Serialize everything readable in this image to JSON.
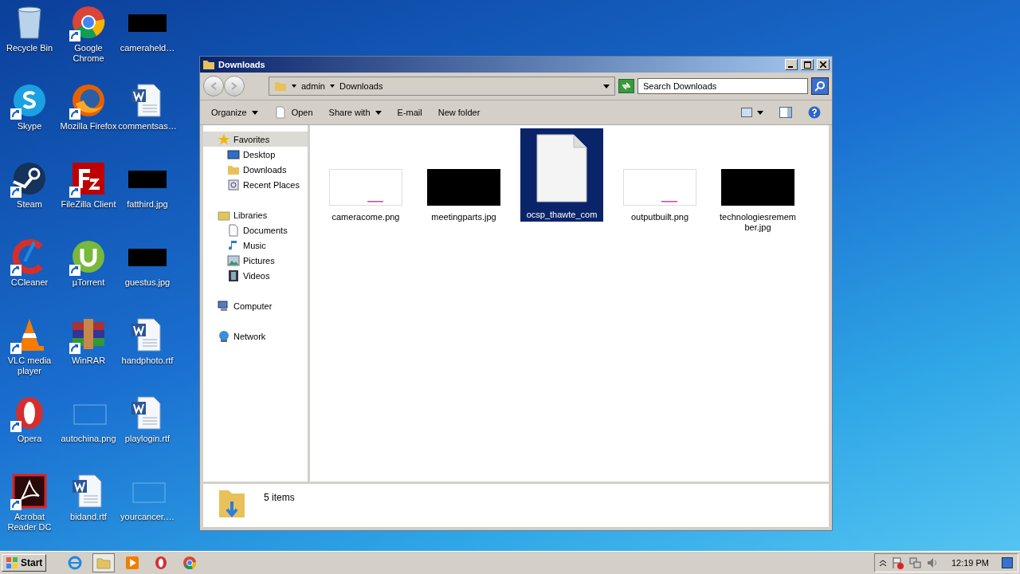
{
  "desktop_icons": [
    {
      "label": "Recycle Bin",
      "kind": "recycle",
      "shortcut": false
    },
    {
      "label": "Skype",
      "kind": "skype",
      "shortcut": true
    },
    {
      "label": "Steam",
      "kind": "steam",
      "shortcut": true
    },
    {
      "label": "CCleaner",
      "kind": "ccleaner",
      "shortcut": true
    },
    {
      "label": "VLC media player",
      "kind": "vlc",
      "shortcut": true
    },
    {
      "label": "Opera",
      "kind": "opera",
      "shortcut": true
    },
    {
      "label": "Acrobat Reader DC",
      "kind": "acrobat",
      "shortcut": true
    },
    {
      "label": "Google Chrome",
      "kind": "chrome",
      "shortcut": true
    },
    {
      "label": "Mozilla Firefox",
      "kind": "firefox",
      "shortcut": true
    },
    {
      "label": "FileZilla Client",
      "kind": "filezilla",
      "shortcut": true
    },
    {
      "label": "µTorrent",
      "kind": "utorrent",
      "shortcut": true
    },
    {
      "label": "WinRAR",
      "kind": "winrar",
      "shortcut": true
    },
    {
      "label": "autochina.png",
      "kind": "blank",
      "shortcut": false
    },
    {
      "label": "bidand.rtf",
      "kind": "word",
      "shortcut": false
    },
    {
      "label": "cameraheld…",
      "kind": "dark",
      "shortcut": false
    },
    {
      "label": "commentsas…",
      "kind": "word",
      "shortcut": false
    },
    {
      "label": "fatthird.jpg",
      "kind": "dark",
      "shortcut": false
    },
    {
      "label": "guestus.jpg",
      "kind": "dark",
      "shortcut": false
    },
    {
      "label": "handphoto.rtf",
      "kind": "word",
      "shortcut": false
    },
    {
      "label": "playlogin.rtf",
      "kind": "word",
      "shortcut": false
    },
    {
      "label": "yourcancer.…",
      "kind": "blank",
      "shortcut": false
    }
  ],
  "window": {
    "title": "Downloads",
    "address": [
      "admin",
      "Downloads"
    ],
    "search": {
      "placeholder": "Search Downloads"
    },
    "toolbar": [
      {
        "label": "Organize",
        "dropdown": true,
        "kind": "text"
      },
      {
        "label": "Open",
        "dropdown": false,
        "kind": "open"
      },
      {
        "label": "Share with",
        "dropdown": true,
        "kind": "text"
      },
      {
        "label": "E-mail",
        "dropdown": false,
        "kind": "text"
      },
      {
        "label": "New folder",
        "dropdown": false,
        "kind": "text"
      }
    ],
    "nav": [
      {
        "label": "Favorites",
        "kind": "star",
        "selected": true,
        "children": [
          {
            "label": "Desktop",
            "kind": "desktop",
            "selected": false
          },
          {
            "label": "Downloads",
            "kind": "folder",
            "selected": false
          },
          {
            "label": "Recent Places",
            "kind": "recent",
            "selected": false
          }
        ]
      },
      {
        "label": "Libraries",
        "kind": "library",
        "selected": false,
        "children": [
          {
            "label": "Documents",
            "kind": "document",
            "selected": false
          },
          {
            "label": "Music",
            "kind": "music",
            "selected": false
          },
          {
            "label": "Pictures",
            "kind": "pictures",
            "selected": false
          },
          {
            "label": "Videos",
            "kind": "videos",
            "selected": false
          }
        ]
      },
      {
        "label": "Computer",
        "kind": "computer",
        "selected": false
      },
      {
        "label": "Network",
        "kind": "network",
        "selected": false
      }
    ],
    "files": [
      {
        "name": "cameracome.png",
        "kind": "light",
        "selected": false
      },
      {
        "name": "meetingparts.jpg",
        "kind": "dark",
        "selected": false
      },
      {
        "name": "ocsp_thawte_com",
        "kind": "document",
        "selected": true
      },
      {
        "name": "outputbuilt.png",
        "kind": "light",
        "selected": false
      },
      {
        "name": "technologiesremember.jpg",
        "kind": "dark",
        "selected": false
      }
    ],
    "status": "5 items"
  },
  "taskbar": {
    "start": "Start",
    "apps": [
      {
        "kind": "ie",
        "active": false
      },
      {
        "kind": "explorer",
        "active": true
      },
      {
        "kind": "media",
        "active": false
      },
      {
        "kind": "opera",
        "active": false
      },
      {
        "kind": "chrome",
        "active": false
      }
    ],
    "clock": "12:19 PM"
  }
}
